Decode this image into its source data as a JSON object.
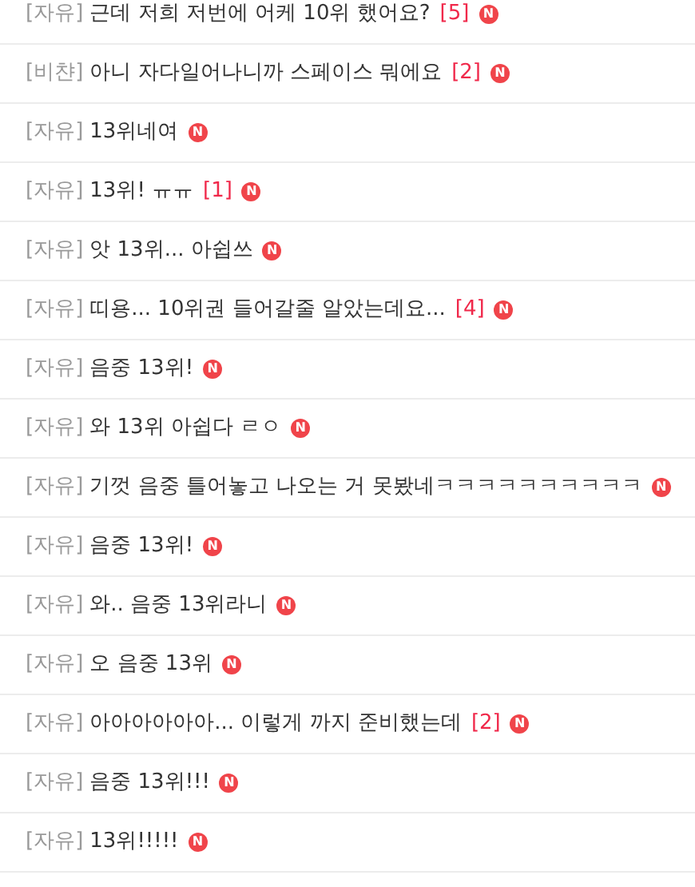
{
  "posts": [
    {
      "category": "[자유]",
      "title": "근데 저희 저번에 어케 10위 했어요?",
      "comments": "[5]",
      "badge": "N"
    },
    {
      "category": "[비챤]",
      "title": "아니 자다일어나니까 스페이스 뭐에요",
      "comments": "[2]",
      "badge": "N"
    },
    {
      "category": "[자유]",
      "title": "13위네여",
      "badge": "N"
    },
    {
      "category": "[자유]",
      "title": "13위! ㅠㅠ",
      "comments": "[1]",
      "badge": "N"
    },
    {
      "category": "[자유]",
      "title": "앗 13위... 아쉽쓰",
      "badge": "N"
    },
    {
      "category": "[자유]",
      "title": "띠용... 10위권 들어갈줄 알았는데요...",
      "comments": "[4]",
      "badge": "N"
    },
    {
      "category": "[자유]",
      "title": "음중 13위!",
      "badge": "N"
    },
    {
      "category": "[자유]",
      "title": "와 13위 아쉽다 ㄹㅇ",
      "badge": "N"
    },
    {
      "category": "[자유]",
      "title": "기껏 음중 틀어놓고 나오는 거 못봤네ㅋㅋㅋㅋㅋㅋㅋㅋㅋㅋ",
      "badge": "N"
    },
    {
      "category": "[자유]",
      "title": "음중 13위!",
      "badge": "N"
    },
    {
      "category": "[자유]",
      "title": "와.. 음중 13위라니",
      "badge": "N"
    },
    {
      "category": "[자유]",
      "title": "오 음중 13위",
      "badge": "N"
    },
    {
      "category": "[자유]",
      "title": "아아아아아아... 이렇게 까지 준비했는데",
      "comments": "[2]",
      "badge": "N"
    },
    {
      "category": "[자유]",
      "title": "음중 13위!!!",
      "badge": "N"
    },
    {
      "category": "[자유]",
      "title": "13위!!!!!",
      "badge": "N"
    }
  ]
}
